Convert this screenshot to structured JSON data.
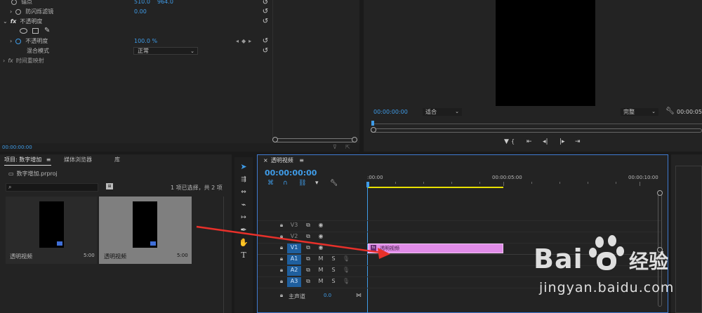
{
  "effect_controls": {
    "anchor_label": "锚点",
    "anchor_x": "510.0",
    "anchor_y": "964.0",
    "flicker_label": "防闪烁滤镜",
    "flicker_value": "0.00",
    "opacity_section": "不透明度",
    "opacity_label": "不透明度",
    "opacity_value": "100.0 %",
    "blend_label": "混合模式",
    "blend_value": "正常",
    "time_remap": "时间重映射",
    "fx": "fx",
    "timecode": "00:00:00:00"
  },
  "program_monitor": {
    "timecode": "00:00:00:00",
    "fit": "适合",
    "quality": "完整",
    "end_timecode": "00:00:05"
  },
  "project": {
    "tab_project": "项目: 数字增加",
    "tab_menu": "≡",
    "tab_media_browser": "媒体浏览器",
    "tab_library": "库",
    "file_name": "数字增加.prproj",
    "selection_info": "1 项已选择，共 2 项",
    "items": [
      {
        "name": "透明视频",
        "duration": "5:00"
      },
      {
        "name": "透明视频",
        "duration": "5:00"
      }
    ]
  },
  "timeline": {
    "tab_name": "透明视频",
    "tab_menu": "≡",
    "timecode": "00:00:00:00",
    "ruler": [
      ":00:00",
      "00:00:05:00",
      "00:00:10:00"
    ],
    "tracks": [
      {
        "id": "V3"
      },
      {
        "id": "V2"
      },
      {
        "id": "V1"
      },
      {
        "id": "A1",
        "m": "M",
        "s": "S"
      },
      {
        "id": "A2",
        "m": "M",
        "s": "S"
      },
      {
        "id": "A3",
        "m": "M",
        "s": "S"
      }
    ],
    "master_label": "主声道",
    "master_value": "0.0",
    "clip_name": "透明视频"
  },
  "watermark": {
    "brand": "Bai",
    "brand_suffix": "经验",
    "url": "jingyan.baidu.com"
  },
  "colors": {
    "accent": "#3f9ce8",
    "clip": "#e18ce8",
    "workarea": "#e8e000",
    "arrow": "#e8302a"
  }
}
